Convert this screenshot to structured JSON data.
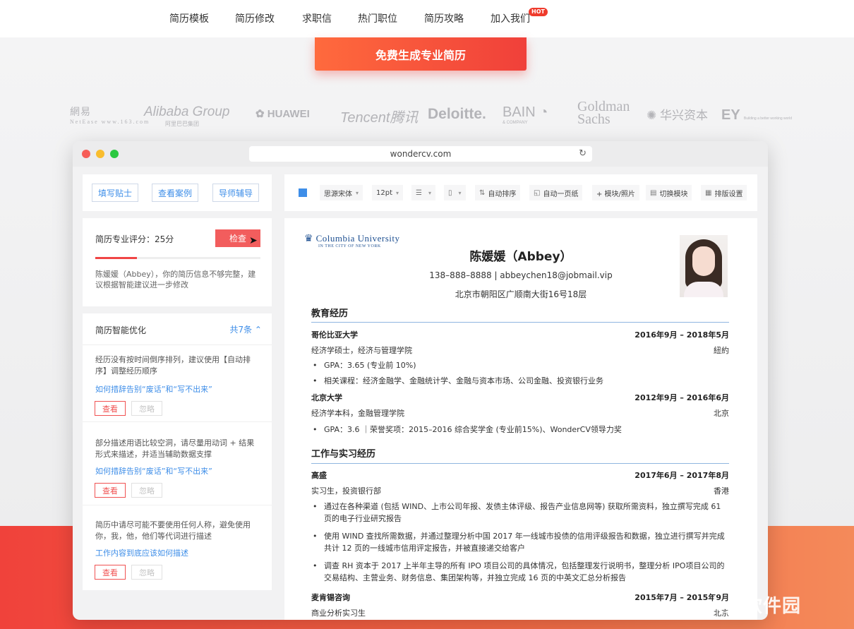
{
  "nav": {
    "items": [
      "简历模板",
      "简历修改",
      "求职信",
      "热门职位",
      "简历攻略",
      "加入我们"
    ],
    "hot_badge": "HOT"
  },
  "hero": {
    "cta_label": "免费生成专业简历",
    "logos": [
      {
        "name": "網易",
        "sub": "NetEase www.163.com"
      },
      {
        "name": "Alibaba Group",
        "sub": "阿里巴巴集团"
      },
      {
        "name": "HUAWEI"
      },
      {
        "name": "Tencent腾讯"
      },
      {
        "name": "Deloitte."
      },
      {
        "name": "BAIN",
        "sub": "& COMPANY"
      },
      {
        "name": "Goldman Sachs"
      },
      {
        "name": "华兴资本"
      },
      {
        "name": "EY",
        "sub": "Building a better working world"
      }
    ]
  },
  "browser": {
    "url": "wondercv.com"
  },
  "left": {
    "tools": [
      "填写贴士",
      "查看案例",
      "导师辅导"
    ],
    "score": {
      "title": "简历专业评分：25分",
      "value": 25,
      "check_label": "检查",
      "desc": "陈媛媛（Abbey），你的简历信息不够完整，建议根据智能建议进一步修改"
    },
    "optimize": {
      "title": "简历智能优化",
      "count": "共7条 ⌃",
      "tips": [
        {
          "text": "经历没有按时间倒序排列，建议使用【自动排序】调整经历顺序",
          "link": "如何措辞告别“废话”和“写不出来”",
          "view": "查看",
          "ignore": "忽略"
        },
        {
          "text": "部分描述用语比较空洞，请尽量用动词 + 结果形式来描述，并适当辅助数据支撑",
          "link": "如何措辞告别“废话”和“写不出来”",
          "view": "查看",
          "ignore": "忽略"
        },
        {
          "text": "简历中请尽可能不要使用任何人称，避免使用你，我，他，他们等代词进行描述",
          "link": "工作内容到底应该如何描述",
          "view": "查看",
          "ignore": "忽略"
        }
      ]
    }
  },
  "toolbar": {
    "color": "#3e8ee8",
    "font": "思源宋体",
    "size": "12pt",
    "auto_sort": "自动排序",
    "one_page": "自动一页纸",
    "module": "+ 模块/照片",
    "switch": "切换模块",
    "layout": "排版设置"
  },
  "resume": {
    "school_logo": "Columbia University",
    "school_logo_sub": "IN THE CITY OF NEW YORK",
    "name": "陈媛媛（Abbey）",
    "contact": "138–888–8888 | abbeychen18@jobmail.vip",
    "address": "北京市朝阳区广顺南大街16号18层",
    "edu_title": "教育经历",
    "edu": [
      {
        "school": "哥伦比亚大学",
        "date": "2016年9月 – 2018年5月",
        "degree": "经济学硕士，经济与管理学院",
        "place": "紐約",
        "bullets": [
          "GPA：3.65 (专业前 10%)",
          "相关课程：经济金融学、金融统计学、金融与资本市场、公司金融、投资银行业务"
        ]
      },
      {
        "school": "北京大学",
        "date": "2012年9月 – 2016年6月",
        "degree": "经济学本科，金融管理学院",
        "place": "北京",
        "bullets": [
          "GPA：3.6 ｜荣誉奖项：2015–2016 综合奖学金 (专业前15%)、WonderCV领导力奖"
        ]
      }
    ],
    "work_title": "工作与实习经历",
    "work": [
      {
        "company": "高盛",
        "date": "2017年6月 – 2017年8月",
        "role": "实习生，投资银行部",
        "place": "香港",
        "bullets": [
          "通过在各种渠道 (包括 WIND、上市公司年报、发债主体评级、报告产业信息网等) 获取所需资料，独立撰写完成 61 页的电子行业研究报告",
          "使用 WIND 查找所需数据，并通过整理分析中国 2017 年一线城市投债的信用评级报告和数据，独立进行撰写并完成共计 12 页的一线城市信用评定报告，并被直接递交给客户",
          "调查 RH 资本于 2017 上半年主导的所有 IPO 项目公司的具体情况，包括整理发行说明书，整理分析 IPO项目公司的交易结构、主营业务、财务信息、集团架构等，并独立完成 16 页的中英文汇总分析报告"
        ]
      },
      {
        "company": "麦肯锡咨询",
        "date": "2015年7月 – 2015年9月",
        "role": "商业分析实习生",
        "place": "北京"
      }
    ]
  },
  "watermark": "人人软件园"
}
